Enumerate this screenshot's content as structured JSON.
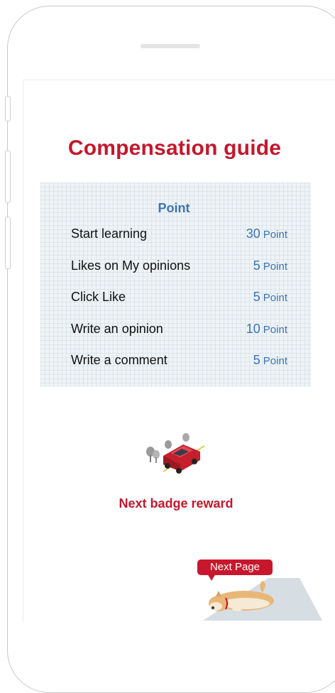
{
  "page": {
    "title": "Compensation guide"
  },
  "points_table": {
    "column_header": "Point",
    "rows": [
      {
        "label": "Start learning",
        "value": "30",
        "unit": "Point"
      },
      {
        "label": "Likes on My opinions",
        "value": "5",
        "unit": "Point"
      },
      {
        "label": "Click Like",
        "value": "5",
        "unit": "Point"
      },
      {
        "label": "Write an opinion",
        "value": "10",
        "unit": "Point"
      },
      {
        "label": "Write a comment",
        "value": "5",
        "unit": "Point"
      }
    ]
  },
  "badge": {
    "label": "Next badge reward",
    "icon": "red-car-illustration"
  },
  "navigation": {
    "next_page_label": "Next Page",
    "mascot": "shiba-dog-illustration"
  },
  "colors": {
    "accent_red": "#c4172c",
    "point_blue": "#3c74b8",
    "table_bg": "#eef3f6"
  }
}
